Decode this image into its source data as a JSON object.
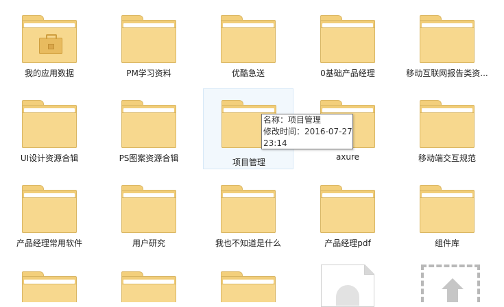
{
  "items": [
    {
      "label": "我的应用数据",
      "icon": "briefcase-folder-icon"
    },
    {
      "label": "PM学习资料",
      "icon": "folder-icon"
    },
    {
      "label": "优酷急送",
      "icon": "folder-icon"
    },
    {
      "label": "0基础产品经理",
      "icon": "folder-icon"
    },
    {
      "label": "移动互联网报告类资...",
      "icon": "folder-icon"
    },
    {
      "label": "UI设计资源合辑",
      "icon": "folder-icon"
    },
    {
      "label": "PS图案资源合辑",
      "icon": "folder-icon"
    },
    {
      "label": "项目管理",
      "icon": "folder-icon"
    },
    {
      "label": "axure",
      "icon": "folder-icon"
    },
    {
      "label": "移动端交互规范",
      "icon": "folder-icon"
    },
    {
      "label": "产品经理常用软件",
      "icon": "folder-icon"
    },
    {
      "label": "用户研究",
      "icon": "folder-icon"
    },
    {
      "label": "我也不知道是什么",
      "icon": "folder-icon"
    },
    {
      "label": "产品经理pdf",
      "icon": "folder-icon"
    },
    {
      "label": "组件库",
      "icon": "folder-icon"
    },
    {
      "label": "",
      "icon": "folder-icon"
    },
    {
      "label": "",
      "icon": "folder-icon"
    },
    {
      "label": "",
      "icon": "folder-icon"
    }
  ],
  "tooltip": {
    "line1": "名称：项目管理",
    "line2": "修改时间：2016-07-27",
    "line3": "23:14"
  },
  "colors": {
    "folder": "#f1cd79",
    "hover": "#f2f8fd",
    "tooltip_border": "#767676"
  }
}
